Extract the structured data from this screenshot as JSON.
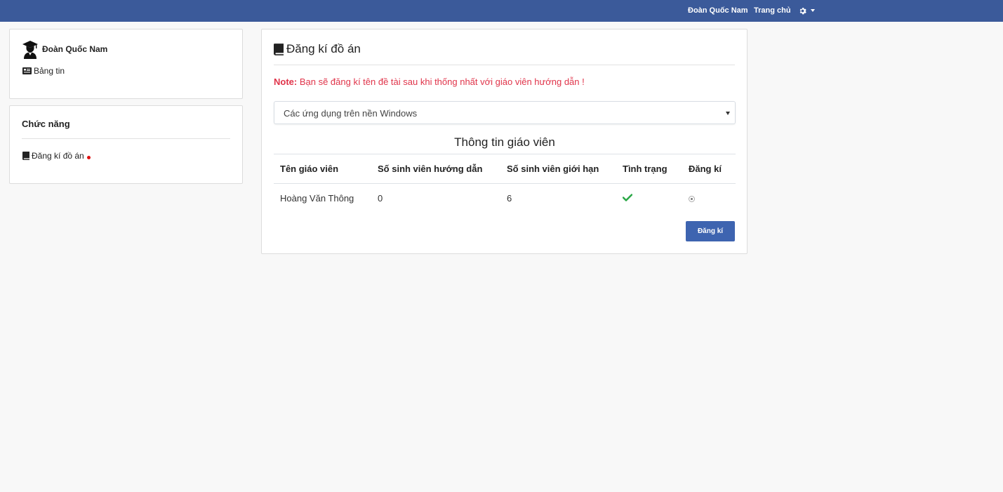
{
  "topnav": {
    "user_name": "Đoàn Quốc Nam",
    "home_label": "Trang chủ",
    "settings_icon": "gear-icon"
  },
  "profile": {
    "name": "Đoàn Quốc Nam",
    "news_label": "Bảng tin"
  },
  "functions": {
    "title": "Chức năng",
    "items": [
      {
        "label": "Đăng kí đồ án",
        "has_notification_dot": true
      }
    ]
  },
  "main": {
    "title": "Đăng kí đồ án",
    "note_prefix": "Note:",
    "note_text": " Bạn sẽ đăng kí tên đề tài sau khi thống nhất với giáo viên hướng dẫn !",
    "project_select": {
      "selected": "Các ứng dụng trên nền Windows"
    },
    "table_caption": "Thông tin giáo viên",
    "columns": [
      "Tên giáo viên",
      "Số sinh viên hướng dẫn",
      "Số sinh viên giới hạn",
      "Tình trạng",
      "Đăng kí"
    ],
    "rows": [
      {
        "teacher": "Hoàng Văn Thông",
        "students_guided": "0",
        "student_limit": "6",
        "status": "available",
        "selected": true
      }
    ],
    "submit_label": "Đăng kí"
  },
  "colors": {
    "navbar": "#3b5a9a",
    "note": "#e0344a",
    "check": "#28a745",
    "button": "#3e64b0"
  }
}
